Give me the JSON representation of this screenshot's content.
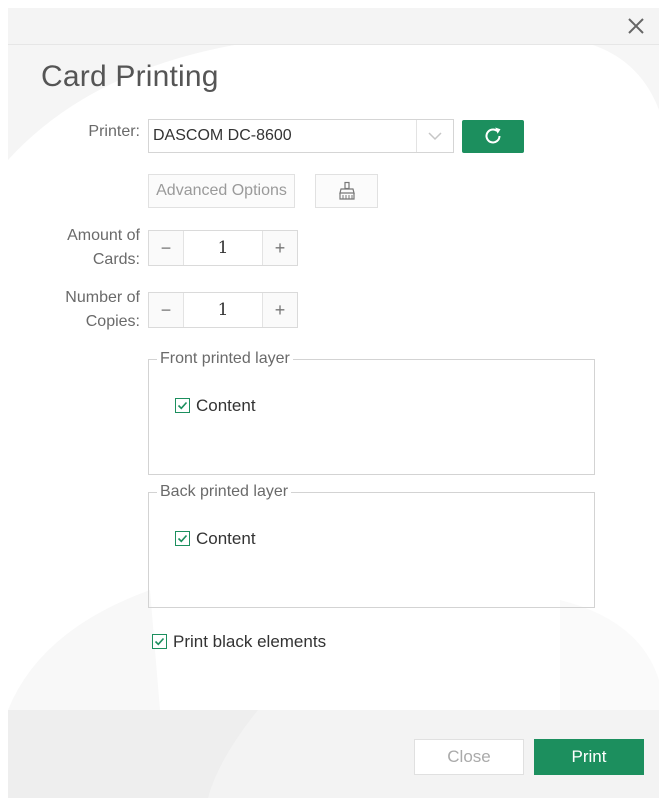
{
  "dialog": {
    "title": "Card Printing",
    "close_icon": "close-icon"
  },
  "printer": {
    "label": "Printer:",
    "selected": "DASCOM DC-8600",
    "refresh_icon": "refresh-icon"
  },
  "advanced": {
    "label": "Advanced Options",
    "clean_icon": "cleaning-brush-icon"
  },
  "amount_of_cards": {
    "label_line1": "Amount of",
    "label_line2": "Cards:",
    "minus": "−",
    "value": "1",
    "plus": "+"
  },
  "number_of_copies": {
    "label_line1": "Number of",
    "label_line2": "Copies:",
    "minus": "−",
    "value": "1",
    "plus": "+"
  },
  "front_layer": {
    "legend": "Front printed layer",
    "content_label": "Content",
    "checked": true
  },
  "back_layer": {
    "legend": "Back printed layer",
    "content_label": "Content",
    "checked": true
  },
  "print_black": {
    "label": "Print black elements",
    "checked": true
  },
  "footer": {
    "close_label": "Close",
    "print_label": "Print"
  },
  "colors": {
    "accent": "#1c8f5e",
    "border": "#d5d5d5",
    "footer_bg": "#f3f3f3"
  }
}
